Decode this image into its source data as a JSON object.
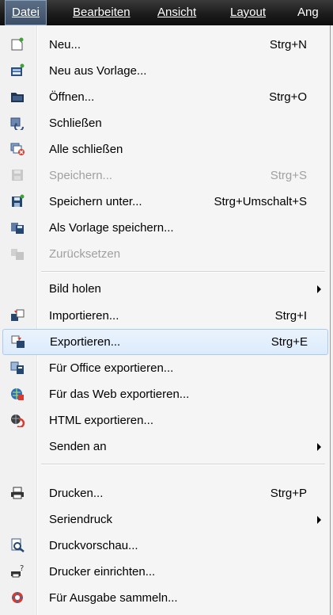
{
  "menubar": {
    "items": [
      {
        "label": "Datei",
        "mnemonic": "D"
      },
      {
        "label": "Bearbeiten",
        "mnemonic": "B"
      },
      {
        "label": "Ansicht",
        "mnemonic": "A"
      },
      {
        "label": "Layout",
        "mnemonic": "L"
      },
      {
        "label": "Ang"
      }
    ]
  },
  "menu": {
    "items": [
      {
        "label": "Neu...",
        "accel": "Strg+N",
        "icon": "new-file-icon"
      },
      {
        "label": "Neu aus Vorlage...",
        "icon": "new-from-template-icon"
      },
      {
        "label": "Öffnen...",
        "accel": "Strg+O",
        "icon": "open-folder-icon"
      },
      {
        "label": "Schließen",
        "icon": "close-document-icon"
      },
      {
        "label": "Alle schließen",
        "icon": "close-all-icon"
      },
      {
        "label": "Speichern...",
        "accel": "Strg+S",
        "icon": "save-icon",
        "disabled": true
      },
      {
        "label": "Speichern unter...",
        "accel": "Strg+Umschalt+S",
        "icon": "save-as-icon"
      },
      {
        "label": "Als Vorlage speichern...",
        "icon": "save-as-template-icon"
      },
      {
        "label": "Zurücksetzen",
        "icon": "revert-icon",
        "disabled": true
      },
      {
        "label": "Bild holen",
        "submenu": true
      },
      {
        "label": "Importieren...",
        "accel": "Strg+I",
        "icon": "import-icon"
      },
      {
        "label": "Exportieren...",
        "accel": "Strg+E",
        "icon": "export-icon",
        "highlighted": true
      },
      {
        "label": "Für Office exportieren...",
        "icon": "export-office-icon"
      },
      {
        "label": "Für das Web exportieren...",
        "icon": "export-web-icon"
      },
      {
        "label": "HTML exportieren...",
        "icon": "export-html-icon"
      },
      {
        "label": "Senden an",
        "submenu": true
      },
      {
        "label": "Drucken...",
        "accel": "Strg+P",
        "icon": "printer-icon"
      },
      {
        "label": "Seriendruck",
        "submenu": true
      },
      {
        "label": "Druckvorschau...",
        "icon": "print-preview-icon"
      },
      {
        "label": "Drucker einrichten...",
        "icon": "printer-setup-icon"
      },
      {
        "label": "Für Ausgabe sammeln...",
        "icon": "collect-output-icon"
      }
    ]
  },
  "colors": {
    "menubar_bg": "#1c1c1c",
    "menu_bg": "#f5f5f5",
    "highlight_border": "#a8cbf1",
    "disabled_text": "#a0a0a0"
  }
}
